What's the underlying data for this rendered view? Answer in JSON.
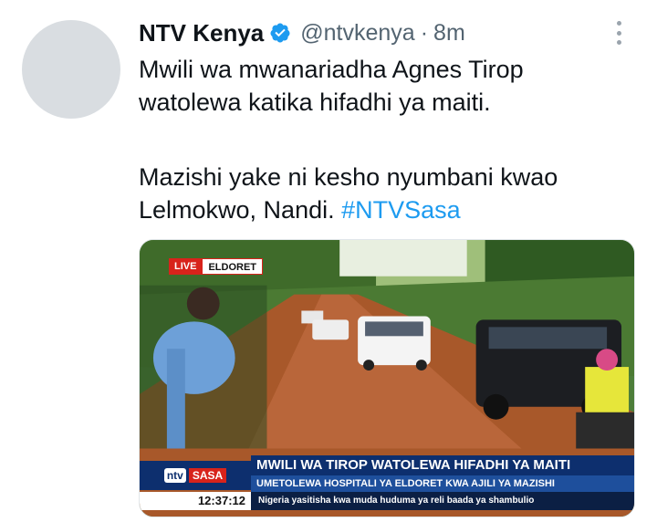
{
  "tweet": {
    "display_name": "NTV Kenya",
    "verified": true,
    "handle": "@ntvkenya",
    "separator": "·",
    "time": "8m",
    "text_line1": "Mwili wa mwanariadha Agnes Tirop",
    "text_line2": "watolewa katika hifadhi ya maiti.",
    "text_line3": "Mazishi yake ni kesho nyumbani kwao",
    "text_line4": "Lelmokwo, Nandi. ",
    "hashtag": "#NTVSasa"
  },
  "media": {
    "live_label": "LIVE",
    "location_label": "ELDORET",
    "brand_ntv": "ntv",
    "brand_sasa": "SASA",
    "headline": "MWILI WA TIROP WATOLEWA HIFADHI YA MAITI",
    "subheadline": "UMETOLEWA HOSPITALI YA ELDORET KWA AJILI YA MAZISHI",
    "clock": "12:37:12",
    "ticker": "Nigeria yasitisha kwa muda huduma ya reli baada ya shambulio"
  },
  "colors": {
    "link": "#1d9bf0",
    "verified_badge": "#1d9bf0",
    "secondary_text": "#536471",
    "news_blue": "#0d2f6e",
    "news_red": "#d8231b"
  },
  "icons": {
    "verified": "verified-badge-icon",
    "more": "more-vertical-icon"
  }
}
